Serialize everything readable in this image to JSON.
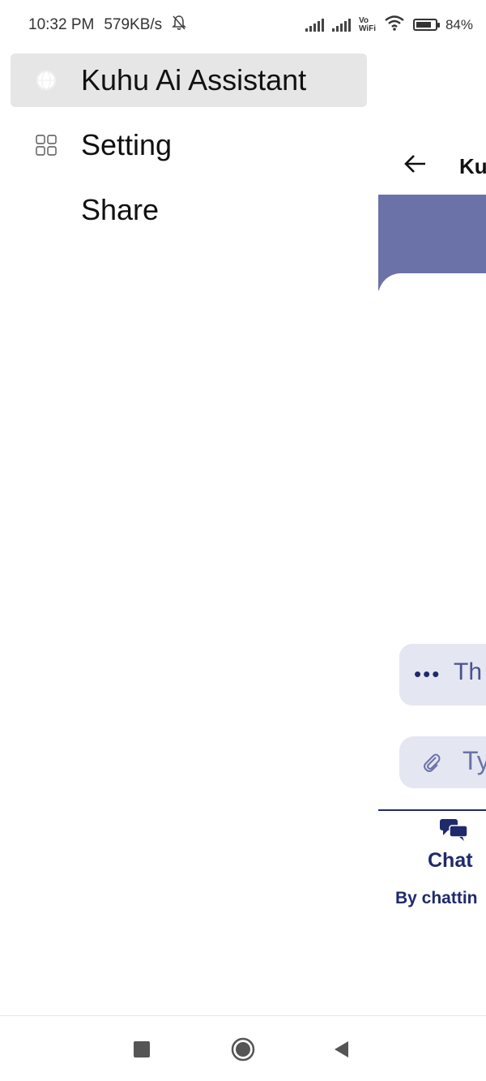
{
  "status_bar": {
    "time": "10:32 PM",
    "speed": "579KB/s",
    "wifi_label_top": "Vo",
    "wifi_label_bottom": "WiFi",
    "battery": "84%",
    "battery_level": 0.84,
    "icons": [
      "bell-off-icon",
      "signal-icon",
      "signal-icon",
      "wifi-icon",
      "battery-icon"
    ]
  },
  "drawer": {
    "items": [
      {
        "label": "Kuhu Ai Assistant",
        "icon": "globe-icon",
        "active": true
      },
      {
        "label": "Setting",
        "icon": "grid-icon",
        "active": false
      },
      {
        "label": "Share",
        "icon": "",
        "active": false
      }
    ]
  },
  "app": {
    "title": "Ku",
    "typing_text": "Th",
    "input_placeholder": "Ty",
    "bottom_tab_label": "Chat",
    "bottom_subtitle": "By chattin",
    "colors": {
      "banner": "#6b72a8",
      "accent": "#1f2a6b",
      "bubble": "#e4e6f1"
    }
  },
  "system_nav": {
    "buttons": [
      "recents-button",
      "home-button",
      "back-button"
    ]
  }
}
